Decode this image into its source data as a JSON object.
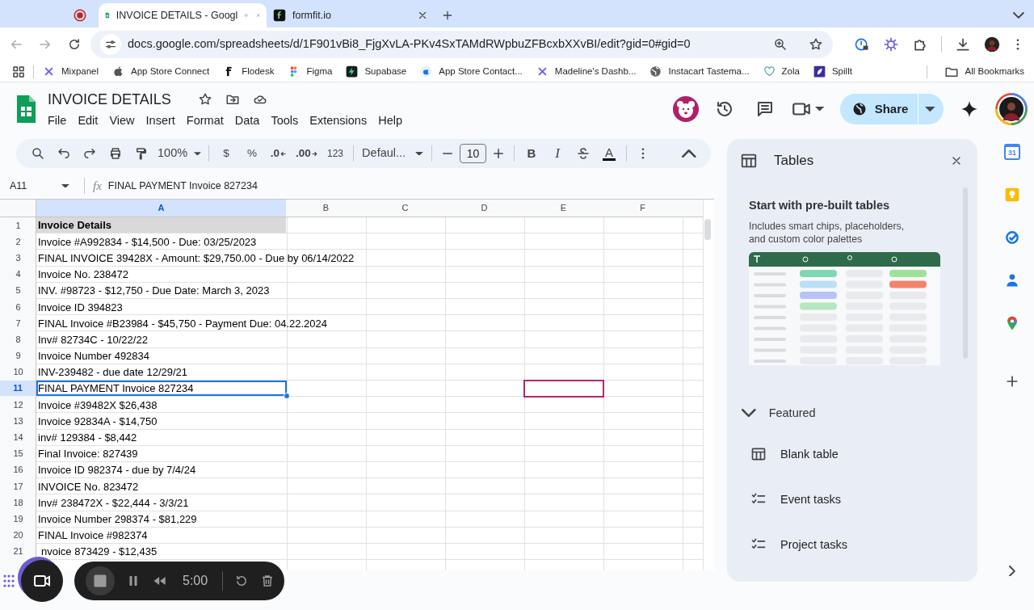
{
  "browser": {
    "tabs": [
      {
        "title": "INVOICE DETAILS - Googl",
        "selected": true,
        "kind": "sheets",
        "audio": true
      },
      {
        "title": "formfit.io",
        "selected": false,
        "kind": "formfit",
        "audio": false
      }
    ],
    "url": "docs.google.com/spreadsheets/d/1F901vBi8_FjgXvLA-PKv4SxTAMdRWpbuZFBcxbXXvBI/edit?gid=0#gid=0",
    "bookmarks": [
      {
        "label": "Mixpanel",
        "kind": "cross"
      },
      {
        "label": "App Store Connect",
        "kind": "apple"
      },
      {
        "label": "Flodesk",
        "kind": "letter"
      },
      {
        "label": "Figma",
        "kind": "figma"
      },
      {
        "label": "Supabase",
        "kind": "bolt"
      },
      {
        "label": "App Store Contact...",
        "kind": "apple-circle"
      },
      {
        "label": "Madeline's Dashb...",
        "kind": "cross"
      },
      {
        "label": "Instacart Tastema...",
        "kind": "globe"
      },
      {
        "label": "Zola",
        "kind": "heart"
      },
      {
        "label": "Spillt",
        "kind": "leaf"
      }
    ],
    "all_bookmarks": "All Bookmarks"
  },
  "document": {
    "title": "INVOICE DETAILS",
    "menu": [
      "File",
      "Edit",
      "View",
      "Insert",
      "Format",
      "Data",
      "Tools",
      "Extensions",
      "Help"
    ],
    "share": "Share"
  },
  "toolbar": {
    "zoom": "100%",
    "currency": "$",
    "percent": "%",
    "decimal_decrease": ".0",
    "decimal_increase": ".00",
    "number_format": "123",
    "font": "Defaul...",
    "font_size": "10",
    "bold": "B",
    "italic": "I",
    "text_color": "A"
  },
  "formula_bar": {
    "cell_ref": "A11",
    "fx": "fx",
    "value": "FINAL PAYMENT Invoice 827234"
  },
  "sheet": {
    "columns": [
      {
        "label": "A",
        "selected": true,
        "remote_cursor": false
      },
      {
        "label": "B",
        "selected": false,
        "remote_cursor": false
      },
      {
        "label": "C",
        "selected": false,
        "remote_cursor": false
      },
      {
        "label": "D",
        "selected": false,
        "remote_cursor": false
      },
      {
        "label": "E",
        "selected": false,
        "remote_cursor": true
      },
      {
        "label": "F",
        "selected": false,
        "remote_cursor": false
      }
    ],
    "rows": [
      {
        "number": "1",
        "text": "Invoice Details",
        "kind": "header",
        "selected": false
      },
      {
        "number": "2",
        "text": "Invoice #A992834 - $14,500 - Due: 03/25/2023",
        "kind": "data",
        "selected": false
      },
      {
        "number": "3",
        "text": "FINAL INVOICE 39428X - Amount: $29,750.00 - Due by 06/14/2022",
        "kind": "data",
        "selected": false
      },
      {
        "number": "4",
        "text": "Invoice No. 238472",
        "kind": "data",
        "selected": false
      },
      {
        "number": "5",
        "text": "INV. #98723 - $12,750 - Due Date: March 3, 2023",
        "kind": "data",
        "selected": false
      },
      {
        "number": "6",
        "text": "Invoice ID 394823",
        "kind": "data",
        "selected": false
      },
      {
        "number": "7",
        "text": "FINAL Invoice #B23984 - $45,750 - Payment Due: 04.22.2024",
        "kind": "data",
        "selected": false
      },
      {
        "number": "8",
        "text": "Inv# 82734C - 10/22/22",
        "kind": "data",
        "selected": false
      },
      {
        "number": "9",
        "text": "Invoice Number 492834",
        "kind": "data",
        "selected": false
      },
      {
        "number": "10",
        "text": "INV-239482 - due date 12/29/21",
        "kind": "data",
        "selected": false
      },
      {
        "number": "11",
        "text": "FINAL PAYMENT Invoice 827234",
        "kind": "data",
        "selected": true,
        "remote_cursor": {
          "color": "#b5266b"
        }
      },
      {
        "number": "12",
        "text": "Invoice #39482X $26,438",
        "kind": "data",
        "selected": false
      },
      {
        "number": "13",
        "text": "Invoice 92834A - $14,750",
        "kind": "data",
        "selected": false
      },
      {
        "number": "14",
        "text": "inv# 129384 - $8,442",
        "kind": "data",
        "selected": false
      },
      {
        "number": "15",
        "text": "Final Invoice: 827439",
        "kind": "data",
        "selected": false
      },
      {
        "number": "16",
        "text": "Invoice ID 982374 - due by 7/4/24",
        "kind": "data",
        "selected": false
      },
      {
        "number": "17",
        "text": "INVOICE No. 823472",
        "kind": "data",
        "selected": false
      },
      {
        "number": "18",
        "text": "Inv# 238472X - $22,444 - 3/3/21",
        "kind": "data",
        "selected": false
      },
      {
        "number": "19",
        "text": "Invoice Number 298374 - $81,229",
        "kind": "data",
        "selected": false
      },
      {
        "number": "20",
        "text": "FINAL Invoice #982374",
        "kind": "data",
        "selected": false
      },
      {
        "number": "21",
        "text": "nvoice 873429 - $12,435",
        "kind": "data",
        "selected": false
      }
    ]
  },
  "side_panel": {
    "title": "Tables",
    "heading": "Start with pre-built tables",
    "description": "Includes smart chips, placeholders, and custom color palettes",
    "section": {
      "label": "Featured",
      "expanded": true
    },
    "items": [
      {
        "label": "Blank table",
        "kind": "table"
      },
      {
        "label": "Event tasks",
        "kind": "checklist"
      },
      {
        "label": "Project tasks",
        "kind": "checklist"
      }
    ]
  },
  "side_rail": {
    "calendar_day": "31"
  },
  "recorder": {
    "time": "5:00"
  }
}
